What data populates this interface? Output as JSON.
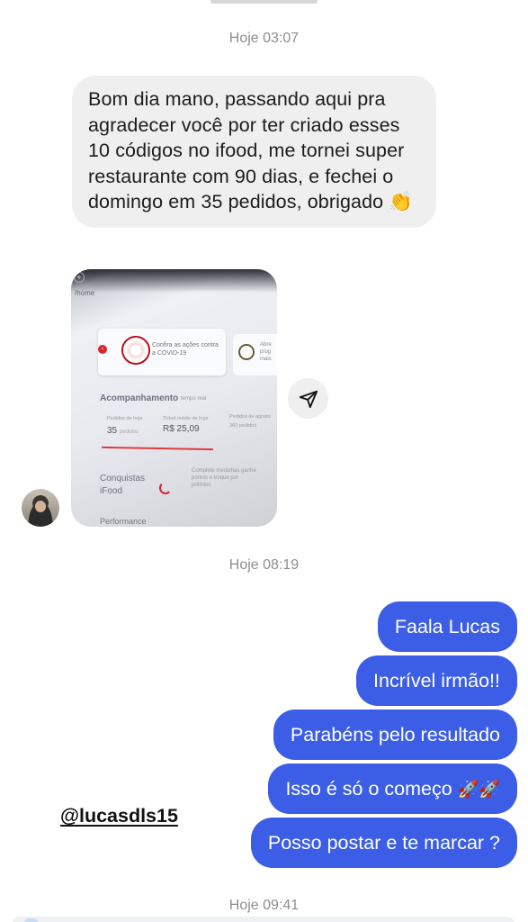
{
  "timestamps": [
    "Hoje 03:07",
    "Hoje 08:19",
    "Hoje 09:41"
  ],
  "incoming": {
    "text": "Bom dia mano, passando aqui pra agradecer você por ter criado esses 10 códigos no ifood, me tornei super restaurante com 90 dias, e fechei o domingo em 35 pedidos, obrigado 👏",
    "photo": {
      "home": "/home",
      "covid_card": [
        "Confira as ações contra",
        "a COVID-19"
      ],
      "side_card": [
        "Abre",
        "prog",
        "mais"
      ],
      "section_title": "Acompanhamento",
      "section_sub": "tempo real",
      "stats": [
        {
          "label": "Pedidos de hoje",
          "value": "35",
          "suffix": "pedidos"
        },
        {
          "label": "Ticket médio de hoje",
          "value": "R$ 25,09"
        },
        {
          "label": "Pedidos de agosto",
          "value": "360 pedidos"
        }
      ],
      "achievements_title": [
        "Conquistas",
        "iFood"
      ],
      "achievements_text": [
        "Complete medalhas ganhe",
        "pontos e troque por",
        "prêmios"
      ],
      "performance": "Performance"
    }
  },
  "share_icon": "paper-plane-icon",
  "outgoing": [
    {
      "text": "Faala Lucas"
    },
    {
      "text": "Incrível irmão!!"
    },
    {
      "text": "Parabéns pelo resultado"
    },
    {
      "text": "Isso é só o começo",
      "emoji": "🚀🚀"
    },
    {
      "text": "Posso postar e te marcar ?"
    }
  ],
  "mention": "@lucasdls15",
  "colors": {
    "outgoing_bubble": "#3c5ee6",
    "incoming_bubble": "#efefef",
    "timestamp": "#8e8e8e"
  }
}
